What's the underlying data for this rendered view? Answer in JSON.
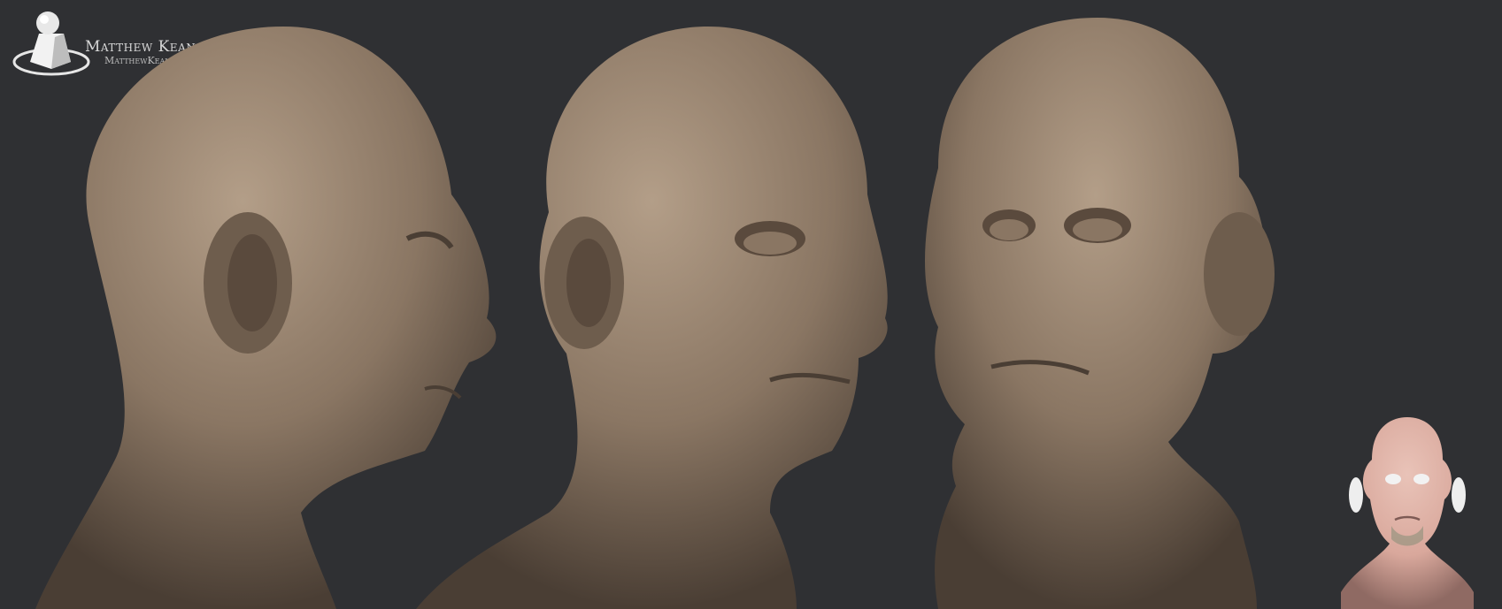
{
  "watermark": {
    "name": "Matthew Kean",
    "url": "MatthewKean.com"
  },
  "colors": {
    "background": "#2f3033",
    "clay": "#8a7663",
    "clay_highlight": "#b39e88",
    "clay_shadow": "#4a3e34",
    "skin_preview": "#d9a89c"
  },
  "views": [
    {
      "name": "profile-right"
    },
    {
      "name": "three-quarter-right"
    },
    {
      "name": "three-quarter-left"
    },
    {
      "name": "color-preview-front"
    }
  ]
}
